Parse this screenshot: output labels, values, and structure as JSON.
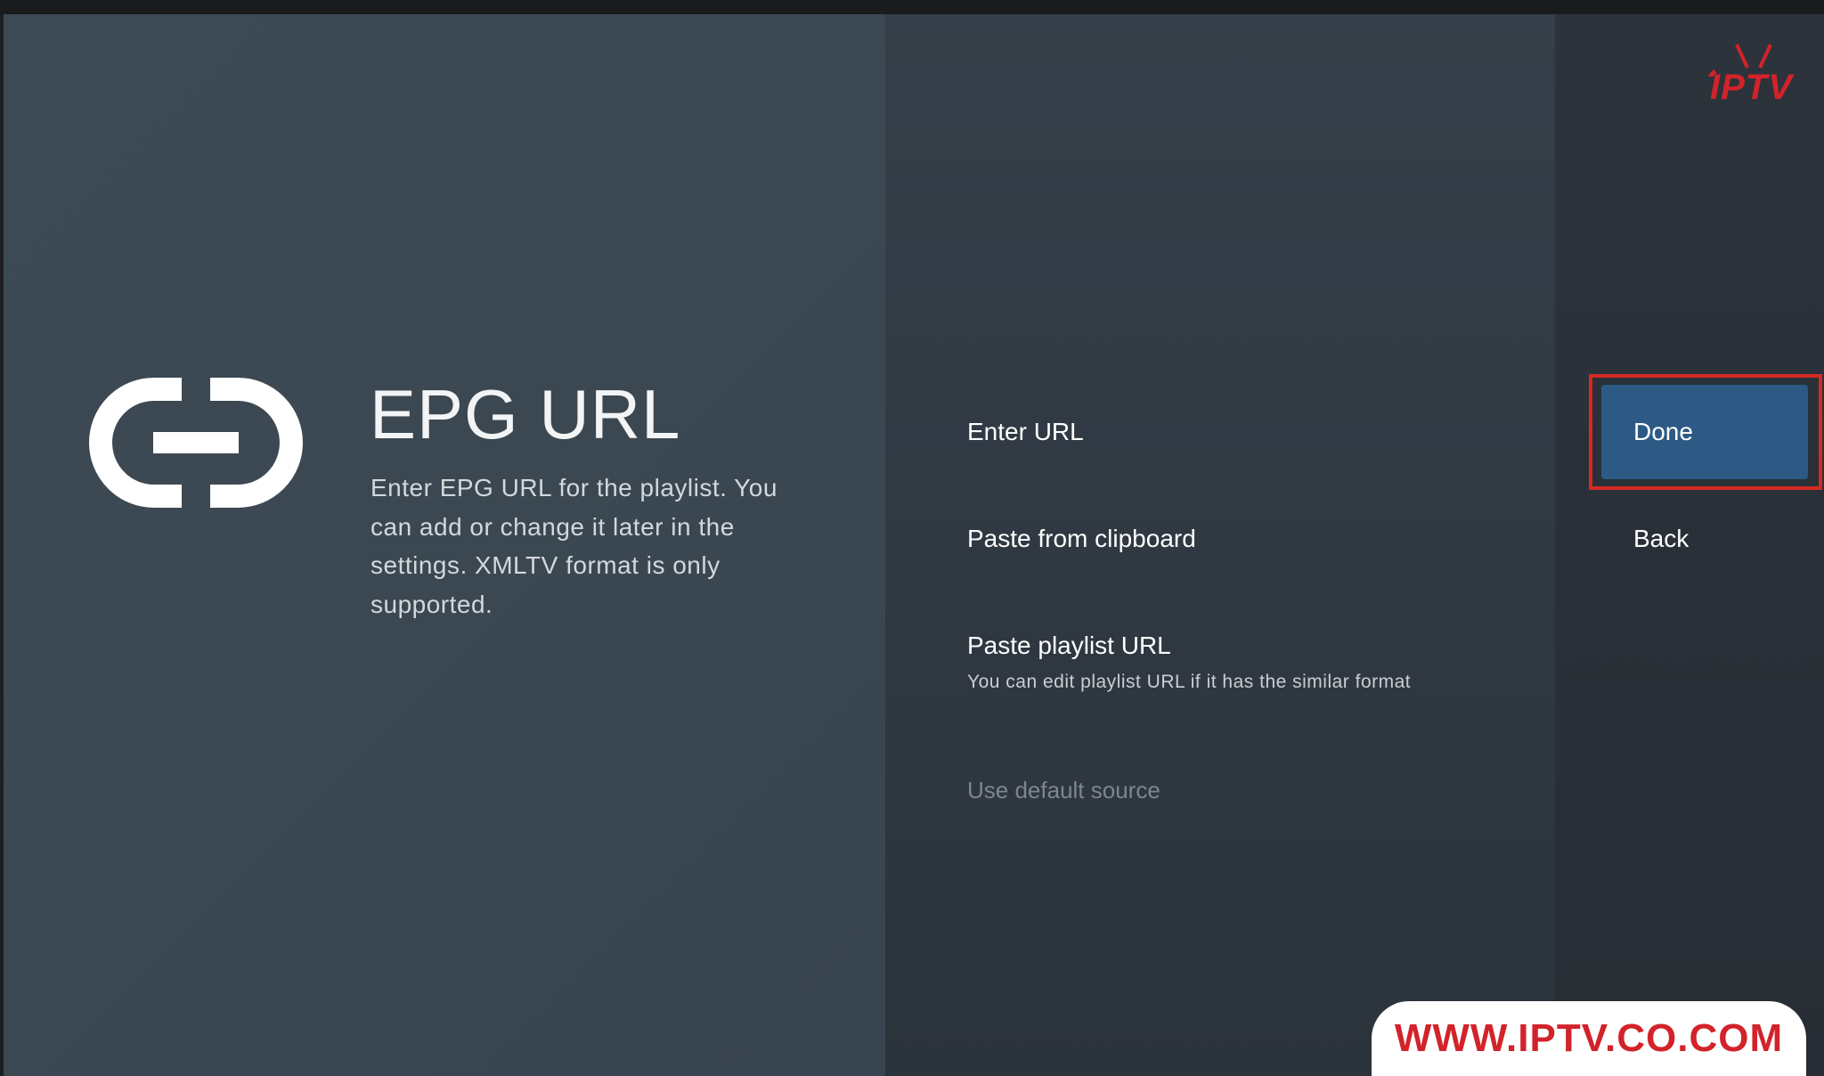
{
  "guidance": {
    "title": "EPG URL",
    "description": "Enter EPG URL for the playlist. You can add or change it later in the settings. XMLTV format is only supported.",
    "icon": "link-icon"
  },
  "actions": {
    "enter_url": "Enter URL",
    "paste_clipboard": "Paste from clipboard",
    "paste_playlist": "Paste playlist URL",
    "paste_playlist_sub": "You can edit playlist URL if it has the similar format",
    "use_default": "Use default source"
  },
  "buttons": {
    "done": "Done",
    "back": "Back"
  },
  "branding": {
    "logo_text": "IPTV",
    "watermark": "WWW.IPTV.CO.COM"
  },
  "colors": {
    "accent": "#2c5a85",
    "highlight": "#d42a22",
    "brand": "#d2232a"
  }
}
